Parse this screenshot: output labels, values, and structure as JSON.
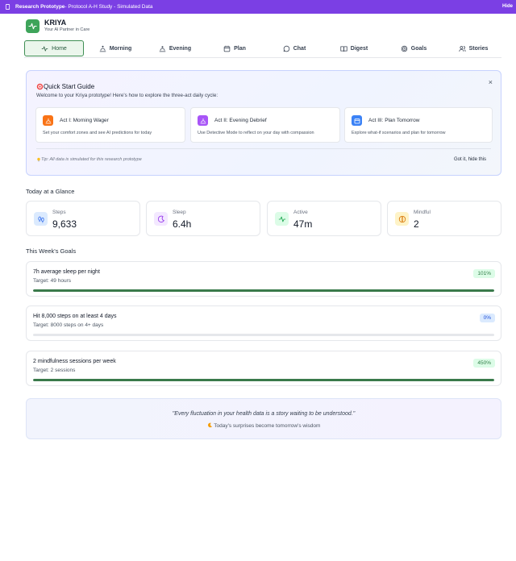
{
  "banner": {
    "icon": "phone-icon",
    "title": "Research Prototype",
    "subtitle": " - Protocol A-H Study - Simulated Data",
    "hide_label": "Hide",
    "color": "#7b3fe4"
  },
  "brand": {
    "name": "KRIYA",
    "tagline": "Your AI Partner in Care",
    "icon": "pulse-icon",
    "color": "#3ea45a"
  },
  "nav": {
    "items": [
      {
        "label": "Home",
        "icon": "pulse-icon",
        "active": true
      },
      {
        "label": "Morning",
        "icon": "sunrise-icon"
      },
      {
        "label": "Evening",
        "icon": "sunset-icon"
      },
      {
        "label": "Plan",
        "icon": "calendar-icon"
      },
      {
        "label": "Chat",
        "icon": "chat-icon"
      },
      {
        "label": "Digest",
        "icon": "book-icon"
      },
      {
        "label": "Goals",
        "icon": "target-icon"
      },
      {
        "label": "Stories",
        "icon": "users-icon"
      }
    ]
  },
  "quick_start": {
    "title": "Quick Start Guide",
    "subtitle": "Welcome to your Kriya prototype! Here's how to explore the three-act daily cycle:",
    "close_label": "×",
    "acts": [
      {
        "title": "Act I: Morning Wager",
        "description": "Set your comfort zones and see AI predictions for today",
        "icon": "sunrise-icon",
        "color": "#f97316"
      },
      {
        "title": "Act II: Evening Debrief",
        "description": "Use Detective Mode to reflect on your day with compassion",
        "icon": "sunset-icon",
        "color": "#a855f7"
      },
      {
        "title": "Act III: Plan Tomorrow",
        "description": "Explore what-if scenarios and plan for tomorrow",
        "icon": "calendar-icon",
        "color": "#3b82f6"
      }
    ],
    "tip": "Tip: All data is simulated for this research prototype",
    "dismiss_label": "Got it, hide this"
  },
  "glance": {
    "title": "Today at a Glance",
    "stats": [
      {
        "label": "Steps",
        "value": "9,633",
        "icon": "footsteps-icon",
        "bg": "#dbeafe",
        "fg": "#2563eb"
      },
      {
        "label": "Sleep",
        "value": "6.4h",
        "icon": "moon-icon",
        "bg": "#f3e8ff",
        "fg": "#9333ea"
      },
      {
        "label": "Active",
        "value": "47m",
        "icon": "pulse-icon",
        "bg": "#dcfce7",
        "fg": "#16a34a"
      },
      {
        "label": "Mindful",
        "value": "2",
        "icon": "meditation-icon",
        "bg": "#fef3c7",
        "fg": "#d97706"
      }
    ]
  },
  "goals": {
    "title": "This Week's Goals",
    "items": [
      {
        "title": "7h average sleep per night",
        "target": "Target: 49 hours",
        "badge": "101%",
        "progress": 100,
        "badge_style": "green"
      },
      {
        "title": "Hit 8,000 steps on at least 4 days",
        "target": "Target: 8000 steps on 4+ days",
        "badge": "0%",
        "progress": 0,
        "badge_style": "blue"
      },
      {
        "title": "2 mindfulness sessions per week",
        "target": "Target: 2 sessions",
        "badge": "450%",
        "progress": 100,
        "badge_style": "green"
      }
    ]
  },
  "quote": {
    "text": "\"Every fluctuation in your health data is a story waiting to be understood.\"",
    "subtext": "Today's surprises become tomorrow's wisdom"
  }
}
